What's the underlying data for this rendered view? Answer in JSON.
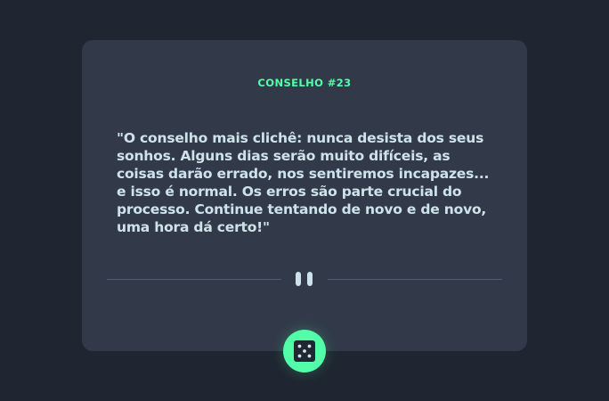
{
  "advice": {
    "id_label": "CONSELHO #23",
    "text": "\"O conselho mais clichê: nunca desista dos seus sonhos. Alguns dias serão muito difíceis, as coisas darão errado, nos sentiremos incapazes... e isso é normal. Os erros são parte crucial do processo. Continue tentando de novo e de novo, uma hora dá certo!\""
  },
  "icons": {
    "divider": "pause-icon",
    "button": "dice-icon"
  },
  "colors": {
    "background": "#1f2631",
    "card": "#323a49",
    "accent": "#52ffa8",
    "text": "#cee3e9",
    "divider": "#4f5d74"
  }
}
